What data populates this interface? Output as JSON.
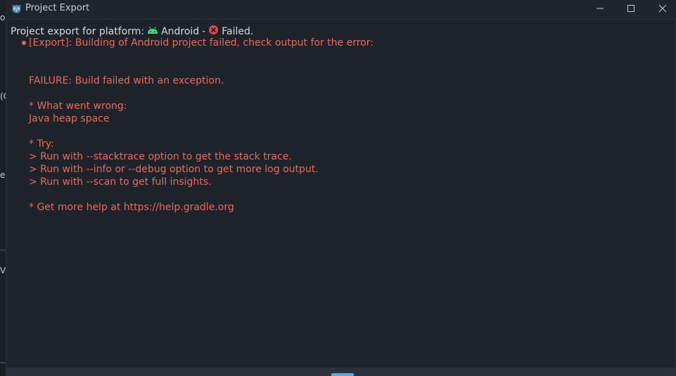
{
  "window": {
    "title": "Project Export",
    "icon": "godot-icon",
    "controls": {
      "minimize": "minimize-icon",
      "maximize": "maximize-icon",
      "close": "close-icon"
    }
  },
  "background_fragments": [
    "o",
    "(C",
    "e l",
    "V"
  ],
  "header": {
    "prefix": "Project export for platform:",
    "platform": "Android",
    "separator": "-",
    "status": "Failed."
  },
  "log": {
    "entry_title": "[Export]: Building of Android project failed, check output for the error:",
    "lines": [
      "FAILURE: Build failed with an exception.",
      "* What went wrong:",
      "Java heap space",
      "* Try:",
      "> Run with --stacktrace option to get the stack trace.",
      "> Run with --info or --debug option to get more log output.",
      "> Run with --scan to get full insights.",
      "* Get more help at https://help.gradle.org"
    ]
  },
  "colors": {
    "error_text": "#ea6a5f",
    "header_text": "#d7dade",
    "android_green": "#3ddc84",
    "failed_red": "#e0464a",
    "accent": "#5fa8e8"
  }
}
